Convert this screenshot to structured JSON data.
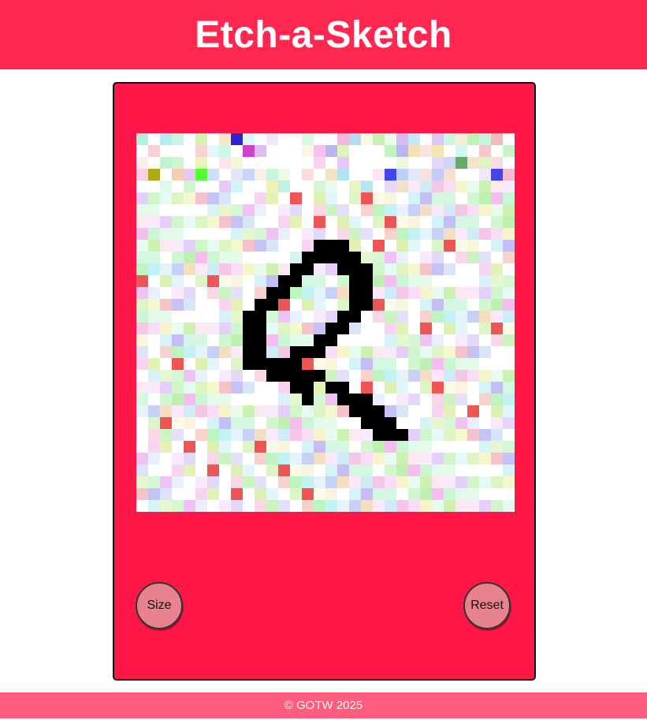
{
  "header": {
    "title": "Etch-a-Sketch"
  },
  "canvas": {
    "grid_columns": 32,
    "grid_rows": 32,
    "drawn_color": "#000000",
    "background_color": "#ffffff"
  },
  "controls": {
    "size_label": "Size",
    "reset_label": "Reset"
  },
  "footer": {
    "text": "© GOTW 2025"
  },
  "colors": {
    "header_bg": "#ff2650",
    "frame_bg": "#ff1847",
    "knob_bg": "#e6838f",
    "footer_bg": "#ff5b7c"
  }
}
